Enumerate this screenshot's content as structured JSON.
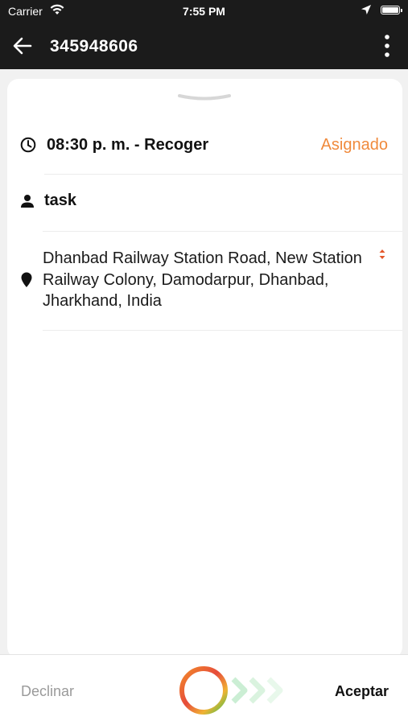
{
  "status_bar": {
    "carrier": "Carrier",
    "time": "7:55 PM",
    "wifi_icon": "wifi-icon",
    "location_icon": "location-arrow-icon",
    "battery_icon": "battery-icon"
  },
  "header": {
    "title": "345948606",
    "back_icon": "arrow-left-icon",
    "menu_icon": "more-vertical-icon",
    "background": "#1b1b1b"
  },
  "task": {
    "time_label": "08:30 p. m. - Recoger",
    "status": "Asignado",
    "status_color": "#f08a3c",
    "name": "task",
    "address": "Dhanbad Railway Station Road, New Station Railway Colony, Damodarpur, Dhanbad, Jharkhand, India",
    "clock_icon": "clock-icon",
    "person_icon": "person-icon",
    "pin_icon": "map-pin-icon",
    "reorder_icon": "reorder-arrows-icon"
  },
  "actions": {
    "decline_label": "Declinar",
    "accept_label": "Aceptar",
    "slider_icon": "swipe-ring-icon",
    "chevron_icon": "chevrons-right-icon"
  }
}
